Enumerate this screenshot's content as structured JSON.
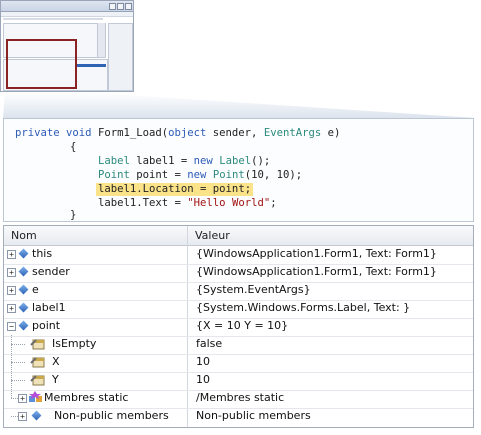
{
  "code": {
    "line1": {
      "kw_private": "private",
      "kw_void": "void",
      "method_head": "Form1_Load(",
      "kw_object": "object",
      "param_sender": " sender, ",
      "type_eventargs": "EventArgs",
      "param_e": " e)"
    },
    "open_brace": "{",
    "line3": {
      "type_label": "Label",
      "decl": " label1 = ",
      "kw_new": "new",
      "type_label2": "Label",
      "tail": "();"
    },
    "line4": {
      "type_point": "Point",
      "decl": " point = ",
      "kw_new": "new",
      "type_point2": "Point",
      "tail": "(10, 10);"
    },
    "line5_highlighted": "label1.Location = point;",
    "line6": {
      "head": "label1.Text = ",
      "string": "\"Hello World\"",
      "tail": ";"
    },
    "close_brace": "}"
  },
  "watch": {
    "columns": {
      "name": "Nom",
      "value": "Valeur"
    },
    "rows": [
      {
        "expander": "+",
        "name": "this",
        "value": "{WindowsApplication1.Form1, Text: Form1}"
      },
      {
        "expander": "+",
        "name": "sender",
        "value": "{WindowsApplication1.Form1, Text: Form1}"
      },
      {
        "expander": "+",
        "name": "e",
        "value": "{System.EventArgs}"
      },
      {
        "expander": "+",
        "name": "label1",
        "value": "{System.Windows.Forms.Label, Text: }"
      },
      {
        "expander": "−",
        "name": "point",
        "value": "{X = 10 Y = 10}"
      },
      {
        "name": "IsEmpty",
        "value": "false"
      },
      {
        "name": "X",
        "value": "10"
      },
      {
        "name": "Y",
        "value": "10"
      },
      {
        "expander": "+",
        "name": "Membres static",
        "value": "/Membres static"
      },
      {
        "expander": "+",
        "name": "Non-public members",
        "value": "Non-public members"
      }
    ]
  },
  "colors": {
    "highlight": "#fbe38a",
    "keyword": "#2d5bb8",
    "type": "#2c8a7d",
    "string": "#a31515",
    "thumbnail_marker": "#8a2323"
  }
}
